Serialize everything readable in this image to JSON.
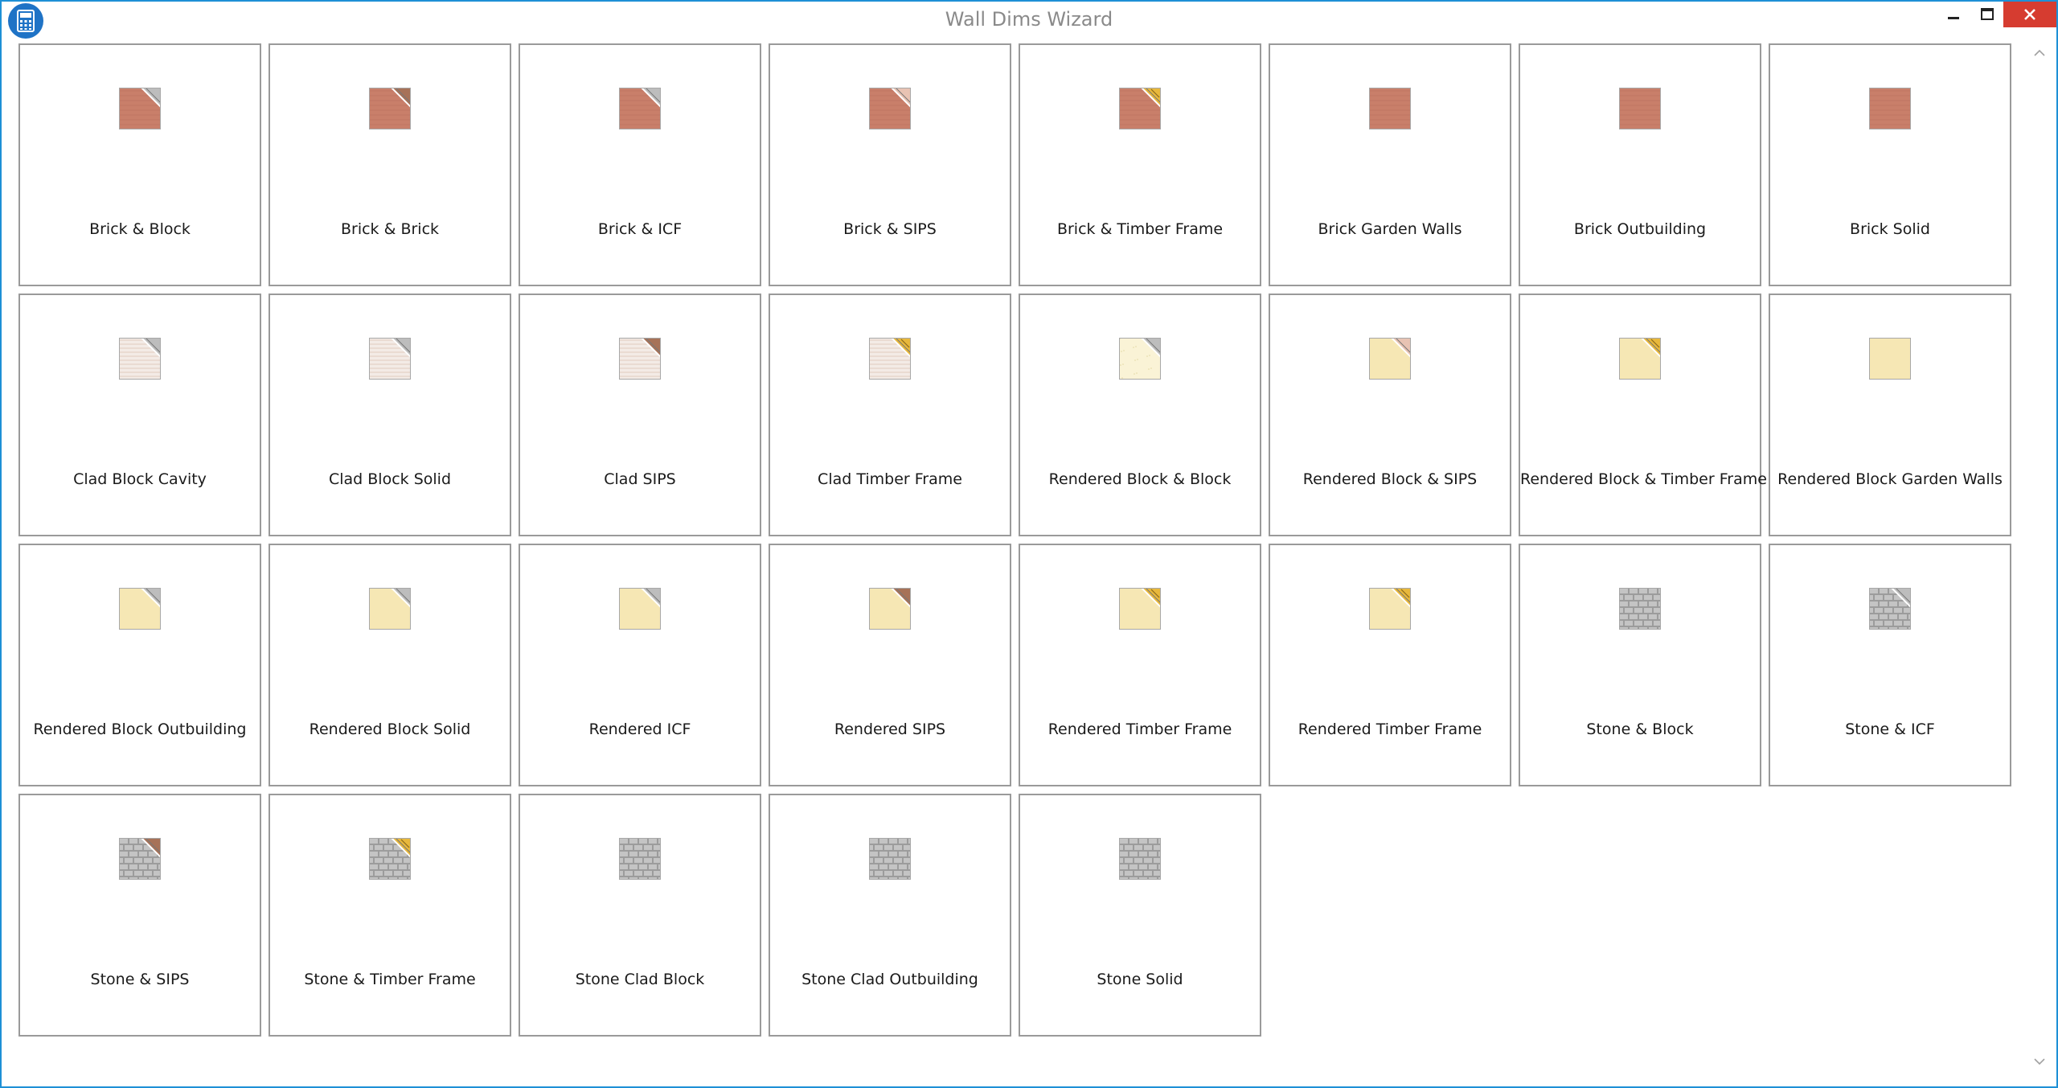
{
  "window": {
    "title": "Wall Dims Wizard"
  },
  "icons": {
    "app": "calculator-icon",
    "minimize": "minimize-icon",
    "maximize": "maximize-icon",
    "close": "close-icon",
    "scroll_up": "chevron-up-icon",
    "scroll_down": "chevron-down-icon"
  },
  "colors": {
    "accent": "#1e90d6",
    "close": "#d63c30",
    "brick": "#c97f6a",
    "render": "#f6e7b4",
    "stone": "#9c9c9c",
    "clad": "#e8d6cc",
    "block": "#bdbdbd",
    "timber": "#e8b83c"
  },
  "walls": [
    {
      "label": "Brick & Block",
      "base": "brick",
      "corner": "block"
    },
    {
      "label": "Brick & Brick",
      "base": "brick",
      "corner": "brickdark"
    },
    {
      "label": "Brick & ICF",
      "base": "brick",
      "corner": "block"
    },
    {
      "label": "Brick & SIPS",
      "base": "brick",
      "corner": "sips"
    },
    {
      "label": "Brick & Timber Frame",
      "base": "brick",
      "corner": "timber"
    },
    {
      "label": "Brick Garden Walls",
      "base": "brick",
      "corner": "none"
    },
    {
      "label": "Brick Outbuilding",
      "base": "brick",
      "corner": "none"
    },
    {
      "label": "Brick Solid",
      "base": "brick",
      "corner": "none"
    },
    {
      "label": "Clad Block Cavity",
      "base": "clad",
      "corner": "block"
    },
    {
      "label": "Clad Block Solid",
      "base": "clad",
      "corner": "block"
    },
    {
      "label": "Clad SIPS",
      "base": "clad",
      "corner": "brickdark"
    },
    {
      "label": "Clad Timber Frame",
      "base": "clad",
      "corner": "timber"
    },
    {
      "label": "Rendered Block & Block",
      "base": "renderlight",
      "corner": "block"
    },
    {
      "label": "Rendered Block & SIPS",
      "base": "render",
      "corner": "sips"
    },
    {
      "label": "Rendered Block & Timber Frame",
      "base": "render",
      "corner": "timber"
    },
    {
      "label": "Rendered Block Garden Walls",
      "base": "render",
      "corner": "none"
    },
    {
      "label": "Rendered Block Outbuilding",
      "base": "render",
      "corner": "block"
    },
    {
      "label": "Rendered Block Solid",
      "base": "render",
      "corner": "block"
    },
    {
      "label": "Rendered ICF",
      "base": "render",
      "corner": "block"
    },
    {
      "label": "Rendered SIPS",
      "base": "render",
      "corner": "brickdark"
    },
    {
      "label": "Rendered Timber Frame",
      "base": "render",
      "corner": "timber"
    },
    {
      "label": "Rendered Timber Frame",
      "base": "render",
      "corner": "timber"
    },
    {
      "label": "Stone & Block",
      "base": "stone",
      "corner": "none"
    },
    {
      "label": "Stone & ICF",
      "base": "stone",
      "corner": "block"
    },
    {
      "label": "Stone & SIPS",
      "base": "stone",
      "corner": "brickdark"
    },
    {
      "label": "Stone & Timber Frame",
      "base": "stone",
      "corner": "timber"
    },
    {
      "label": "Stone Clad Block",
      "base": "stone",
      "corner": "none"
    },
    {
      "label": "Stone Clad Outbuilding",
      "base": "stone",
      "corner": "none"
    },
    {
      "label": "Stone Solid",
      "base": "stone",
      "corner": "none"
    }
  ]
}
